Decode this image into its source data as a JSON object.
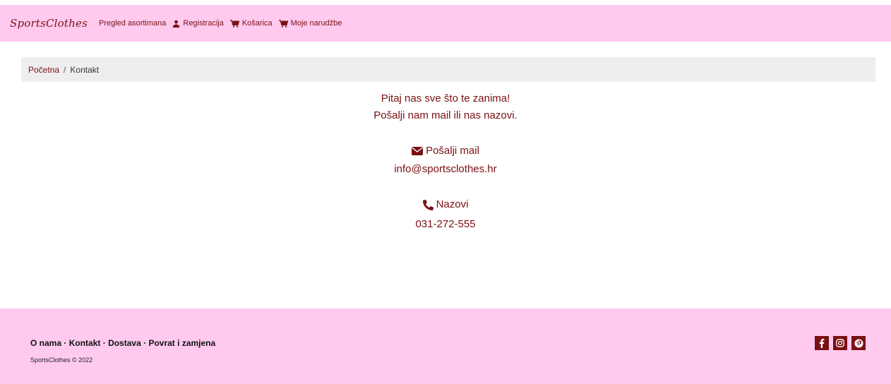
{
  "navbar": {
    "brand": "SportsClothes",
    "items": [
      {
        "label": "Pregled asortimana",
        "icon": ""
      },
      {
        "label": "Registracija",
        "icon": "user-icon"
      },
      {
        "label": "Košarica",
        "icon": "cart-icon"
      },
      {
        "label": "Moje narudžbe",
        "icon": "cart-icon"
      }
    ]
  },
  "breadcrumb": {
    "home": "Početna",
    "separator": "/",
    "current": "Kontakt"
  },
  "content": {
    "line1": "Pitaj nas sve što te zanima!",
    "line2": "Pošalji nam mail ili nas nazovi.",
    "mail_heading": "Pošalji mail",
    "mail_value": "info@sportsclothes.hr",
    "phone_heading": "Nazovi",
    "phone_value": "031-272-555"
  },
  "footer": {
    "links": [
      "O nama",
      "Kontakt",
      "Dostava",
      "Povrat i zamjena"
    ],
    "separator": "·",
    "copyright": "SportsClothes © 2022",
    "social_icons": [
      "facebook-icon",
      "instagram-icon",
      "pinterest-icon"
    ]
  },
  "colors": {
    "accent": "#7a1014",
    "pink": "#ffcaee",
    "breadcrumb_bg": "#eeeeee"
  }
}
